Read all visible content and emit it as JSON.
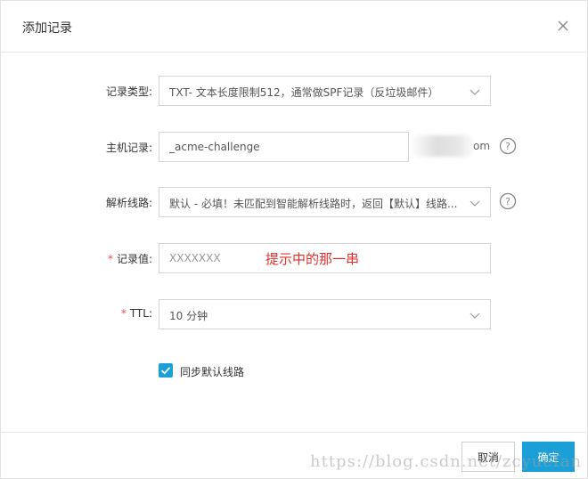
{
  "dialog": {
    "title": "添加记录",
    "close_icon": "close-icon"
  },
  "form": {
    "record_type": {
      "label": "记录类型:",
      "value": "TXT- 文本长度限制512，通常做SPF记录（反垃圾邮件）"
    },
    "host": {
      "label": "主机记录:",
      "value": "_acme-challenge",
      "domain_suffix": "om"
    },
    "line": {
      "label": "解析线路:",
      "value": "默认 - 必填！未匹配到智能解析线路时，返回【默认】线路..."
    },
    "record_value": {
      "required_mark": "*",
      "label": "记录值:",
      "placeholder": "XXXXXXX",
      "annotation": "提示中的那一串"
    },
    "ttl": {
      "required_mark": "*",
      "label": "TTL:",
      "value": "10 分钟"
    },
    "sync": {
      "label": "同步默认线路",
      "checked": true
    }
  },
  "footer": {
    "cancel_label": "取消",
    "ok_label": "确定"
  },
  "watermark": "https://blog.csdn.net/zcyuefan",
  "colors": {
    "primary": "#1aa0d6",
    "required": "#e34c4c",
    "annotation": "#e0312c"
  }
}
